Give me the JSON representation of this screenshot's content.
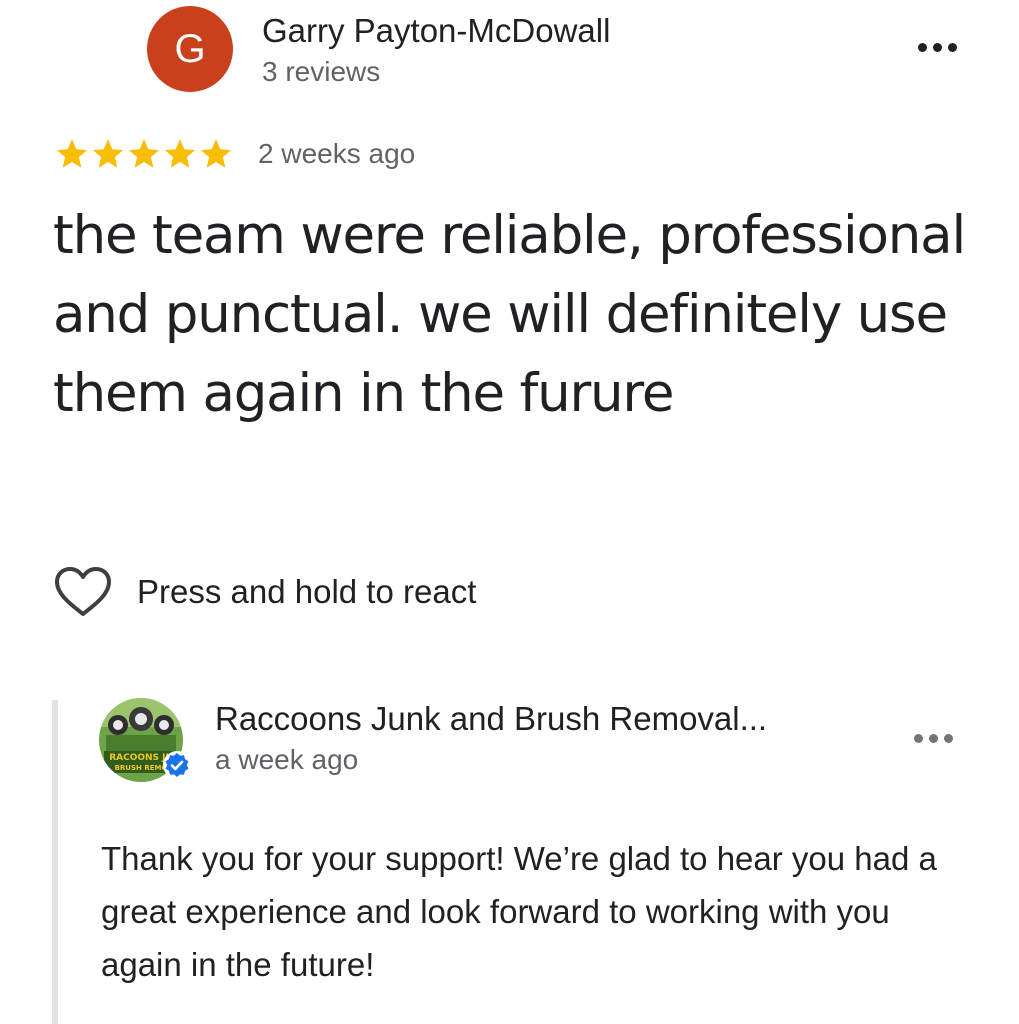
{
  "review": {
    "author": {
      "initial": "G",
      "name": "Garry Payton-McDowall",
      "meta": "3 reviews",
      "avatar_color": "#c9401c"
    },
    "rating": 5,
    "rating_max": 5,
    "star_color": "#fbbc04",
    "date": "2 weeks ago",
    "text": "the team were reliable, professional and punctual. we will definitely use them again in the furure",
    "react_label": "Press and hold to react",
    "menu_icon": "more-horizontal-icon"
  },
  "reply": {
    "owner_name": "Raccoons Junk and Brush Removal...",
    "date": "a week ago",
    "avatar_text_line1": "RACOONS JU",
    "avatar_text_line2": "BRUSH REMO",
    "verified_color": "#1a73e8",
    "text": "Thank you for your support! We’re glad to hear you had a great experience and look forward to working with you again in the future!",
    "menu_icon": "more-horizontal-icon"
  }
}
